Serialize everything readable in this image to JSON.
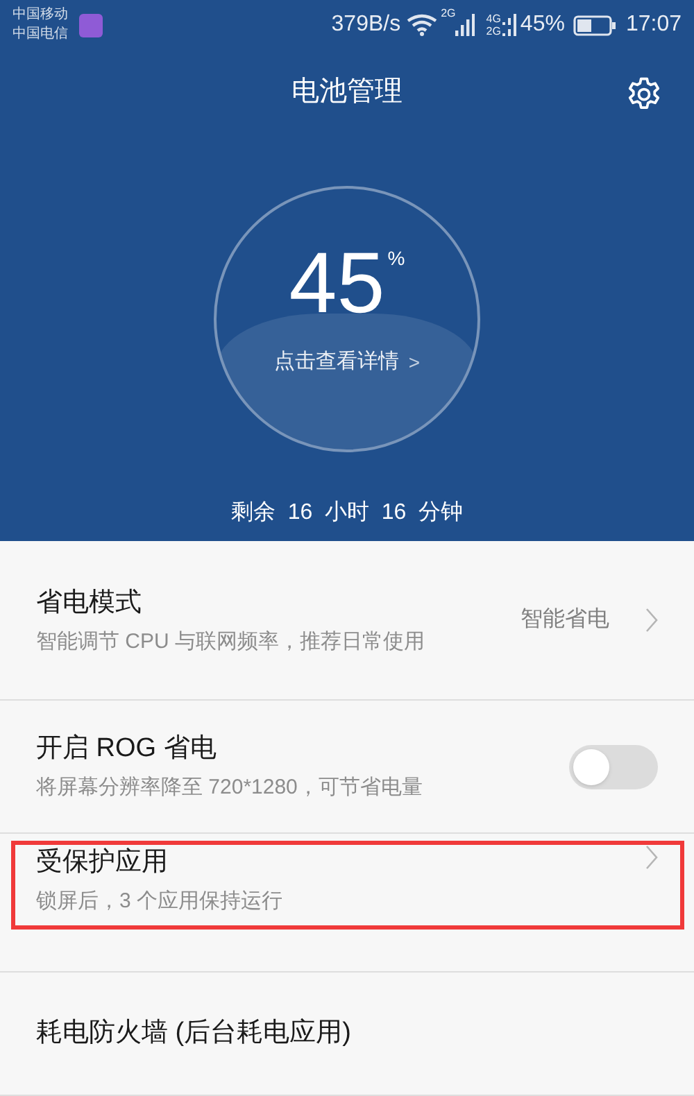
{
  "status_bar": {
    "carriers": [
      "中国移动",
      "中国电信"
    ],
    "speed": "379B/s",
    "net_a": "2G",
    "net_b": [
      "4G",
      "2G"
    ],
    "battery": "45%",
    "time": "17:07"
  },
  "header": {
    "title": "电池管理"
  },
  "battery_circle": {
    "percent": "45",
    "unit": "%",
    "details_link": "点击查看详情",
    "details_arrow": ">"
  },
  "remaining": "剩余  16  小时  16  分钟",
  "settings": [
    {
      "kind": "link",
      "title": "省电模式",
      "description": "智能调节 CPU 与联网频率，推荐日常使用",
      "value": "智能省电",
      "highlighted": false
    },
    {
      "kind": "toggle",
      "title": "开启 ROG 省电",
      "description": "将屏幕分辨率降至 720*1280，可节省电量",
      "on": false,
      "highlighted": false
    },
    {
      "kind": "link",
      "title": "受保护应用",
      "description": "锁屏后，3 个应用保持运行",
      "highlighted": true
    },
    {
      "kind": "plain",
      "title": "耗电防火墙 (后台耗电应用)",
      "highlighted": false
    }
  ]
}
